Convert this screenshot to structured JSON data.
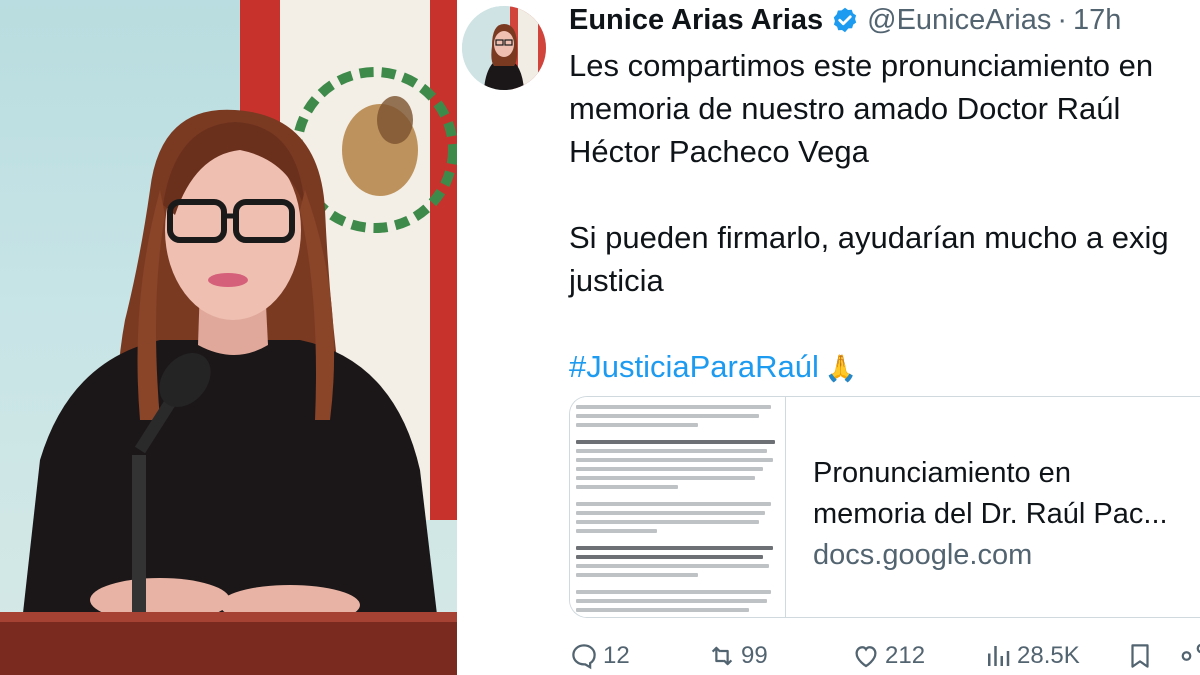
{
  "tweet": {
    "display_name": "Eunice Arias Arias",
    "verified_icon": "verified-badge-icon",
    "handle": "@EuniceArias",
    "separator": "·",
    "time": "17h",
    "text_lines": [
      "Les compartimos este pronunciamiento en",
      "memoria de nuestro amado Doctor Raúl",
      "Héctor Pacheco Vega"
    ],
    "text_line_2": [
      "Si pueden firmarlo, ayudarían mucho a exig",
      "justicia"
    ],
    "hashtag": "#JusticiaParaRaúl",
    "emoji": "🙏",
    "link_card": {
      "title_lines": [
        "Pronunciamiento en",
        "memoria del Dr. Raúl Pac..."
      ],
      "domain": "docs.google.com"
    },
    "actions": {
      "replies": "12",
      "reposts": "99",
      "likes": "212",
      "views": "28.5K"
    }
  },
  "colors": {
    "link_blue": "#1d9bf0",
    "muted_gray": "#536471",
    "text": "#0f1419"
  }
}
